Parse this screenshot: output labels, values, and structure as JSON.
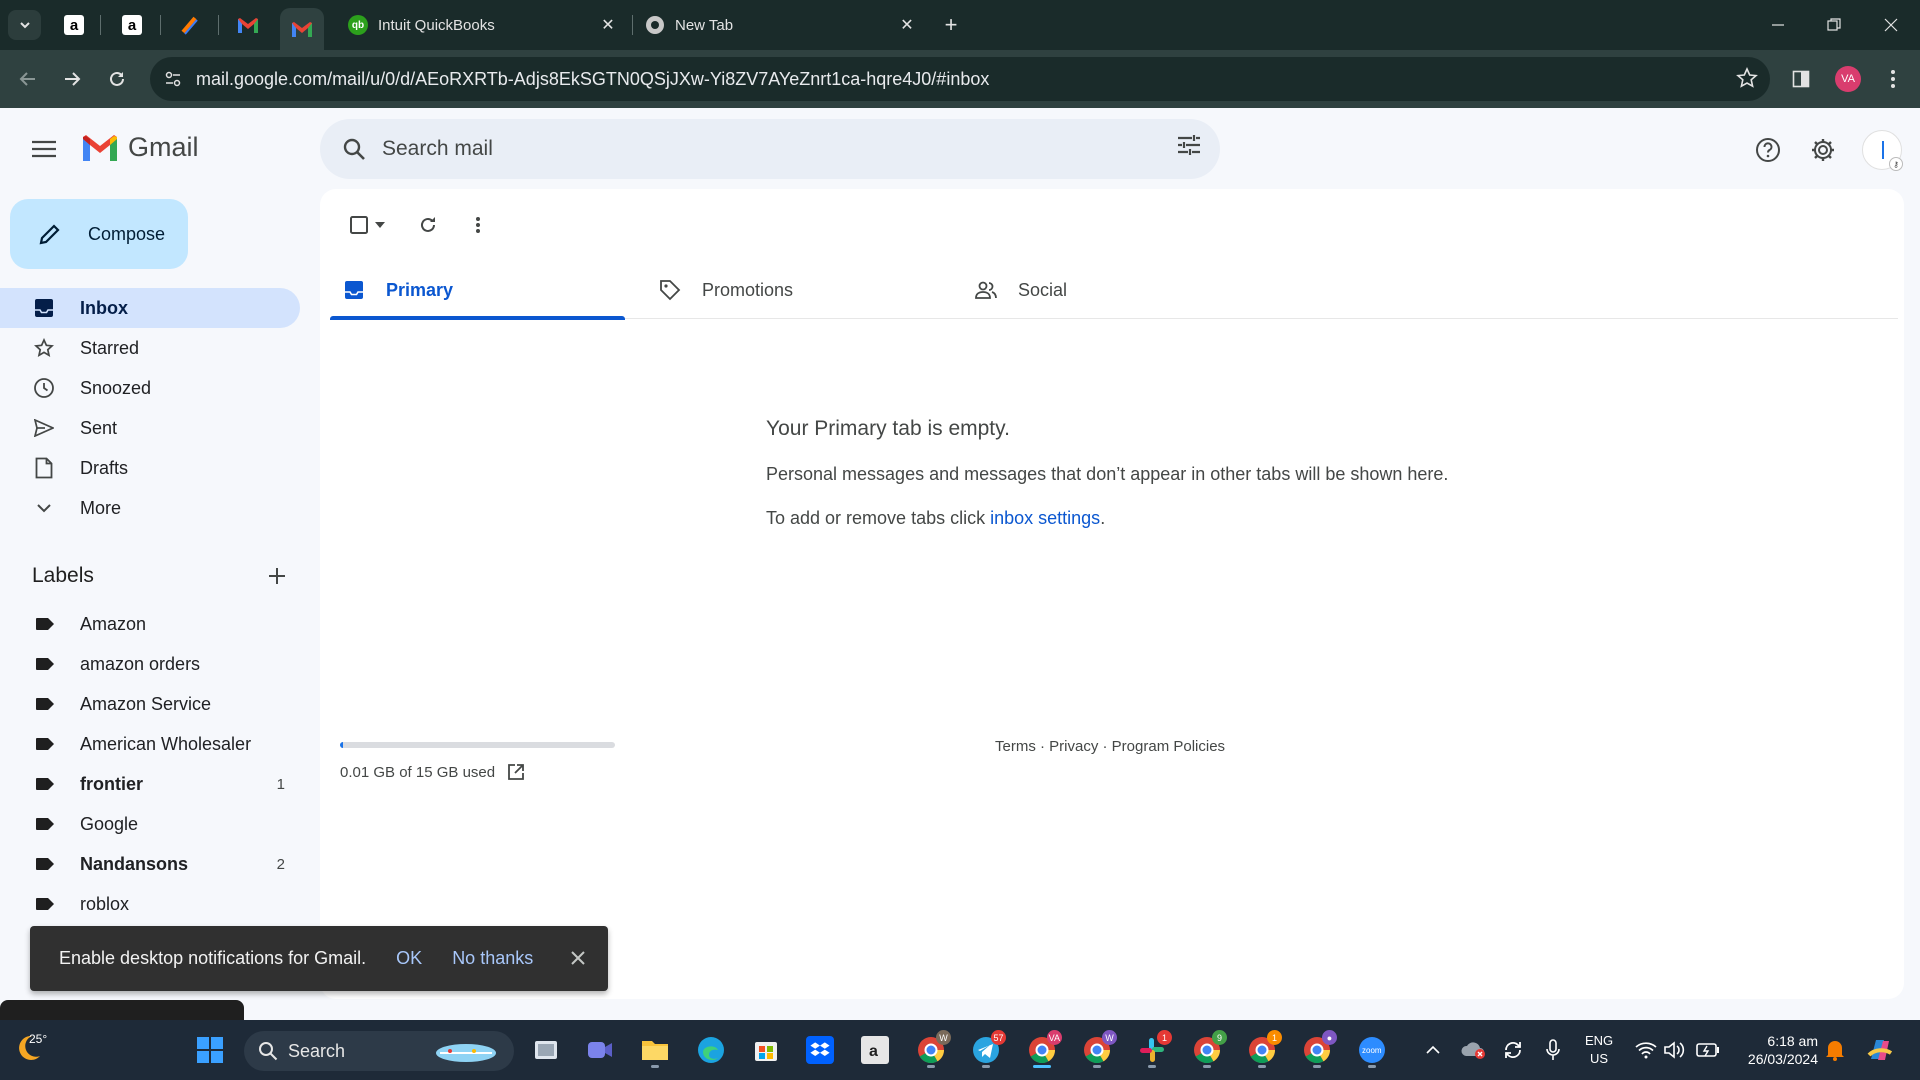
{
  "browser": {
    "tabs": [
      {
        "title": "Intuit QuickBooks",
        "icon": "quickbooks-icon"
      },
      {
        "title": "New Tab",
        "icon": "chrome-icon"
      }
    ],
    "url": "mail.google.com/mail/u/0/d/AEoRXRTb-Adjs8EkSGTN0QSjJXw-Yi8ZV7AYeZnrt1ca-hqre4J0/#inbox",
    "profile_initials": "VA"
  },
  "gmail": {
    "logo_text": "Gmail",
    "search_placeholder": "Search mail",
    "compose_label": "Compose",
    "nav": [
      {
        "label": "Inbox",
        "icon": "inbox-icon",
        "active": true
      },
      {
        "label": "Starred",
        "icon": "star-icon"
      },
      {
        "label": "Snoozed",
        "icon": "clock-icon"
      },
      {
        "label": "Sent",
        "icon": "send-icon"
      },
      {
        "label": "Drafts",
        "icon": "draft-icon"
      },
      {
        "label": "More",
        "icon": "chevron-down-icon"
      }
    ],
    "labels_title": "Labels",
    "labels": [
      {
        "name": "Amazon",
        "count": ""
      },
      {
        "name": "amazon orders",
        "count": ""
      },
      {
        "name": "Amazon Service",
        "count": ""
      },
      {
        "name": "American Wholesaler",
        "count": ""
      },
      {
        "name": "frontier",
        "count": "1",
        "bold": true
      },
      {
        "name": "Google",
        "count": ""
      },
      {
        "name": "Nandansons",
        "count": "2",
        "bold": true
      },
      {
        "name": "roblox",
        "count": ""
      }
    ],
    "category_tabs": [
      {
        "label": "Primary",
        "icon": "inbox-tab-icon",
        "active": true
      },
      {
        "label": "Promotions",
        "icon": "tag-icon"
      },
      {
        "label": "Social",
        "icon": "people-icon"
      }
    ],
    "empty_state": {
      "title": "Your Primary tab is empty.",
      "subtitle": "Personal messages and messages that don’t appear in other tabs will be shown here.",
      "hint_prefix": "To add or remove tabs click ",
      "hint_link": "inbox settings",
      "hint_suffix": "."
    },
    "storage": {
      "text": "0.01 GB of 15 GB used",
      "used_fraction": 0.001
    },
    "footer": "Terms · Privacy · Program Policies",
    "snackbar": {
      "message": "Enable desktop notifications for Gmail.",
      "ok": "OK",
      "no_thanks": "No thanks"
    }
  },
  "taskbar": {
    "weather_temp": "25°",
    "search_label": "Search",
    "badges": {
      "telegram": "57",
      "slack": "1",
      "chrome_green": "9",
      "chrome_orange": "1"
    },
    "lang_line1": "ENG",
    "lang_line2": "US",
    "time": "6:18 am",
    "date": "26/03/2024"
  },
  "colors": {
    "accent": "#0b57d0",
    "active_nav": "#d3e3fd",
    "compose_bg": "#c2e7ff",
    "chrome_dark": "#1a2b2a",
    "chrome_toolbar": "#2f4140"
  }
}
